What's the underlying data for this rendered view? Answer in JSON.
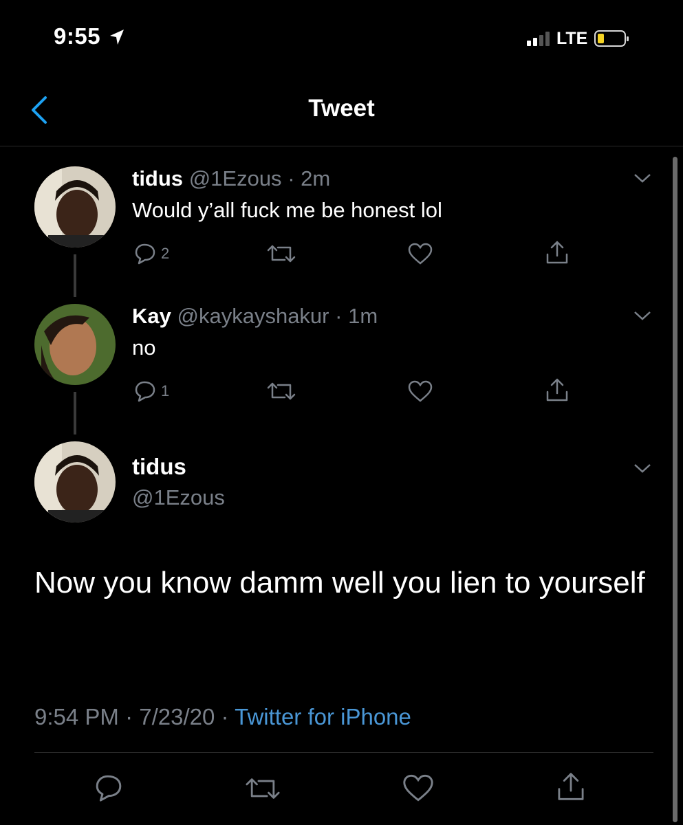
{
  "status_bar": {
    "time": "9:55",
    "network": "LTE"
  },
  "header": {
    "title": "Tweet"
  },
  "thread": [
    {
      "name": "tidus",
      "handle": "@1Ezous",
      "time": "2m",
      "sep": "·",
      "text": "Would y’all fuck me be honest lol",
      "reply_count": "2"
    },
    {
      "name": "Kay",
      "handle": "@kaykayshakur",
      "time": "1m",
      "sep": "·",
      "text": "no",
      "reply_count": "1"
    }
  ],
  "main_tweet": {
    "name": "tidus",
    "handle": "@1Ezous",
    "text": "Now you know damm well you  lien to yourself",
    "time": "9:54 PM",
    "date": "7/23/20",
    "sep": "·",
    "source": "Twitter for iPhone"
  },
  "icons": [
    "location-arrow-icon",
    "signal-icon",
    "battery-icon",
    "back-chevron-icon",
    "chevron-down-icon",
    "reply-icon",
    "retweet-icon",
    "like-icon",
    "share-icon"
  ],
  "colors": {
    "background": "#000000",
    "accent": "#1da1f2",
    "muted": "#7a8089",
    "battery": "#f5d323",
    "link": "#4a97d6"
  }
}
